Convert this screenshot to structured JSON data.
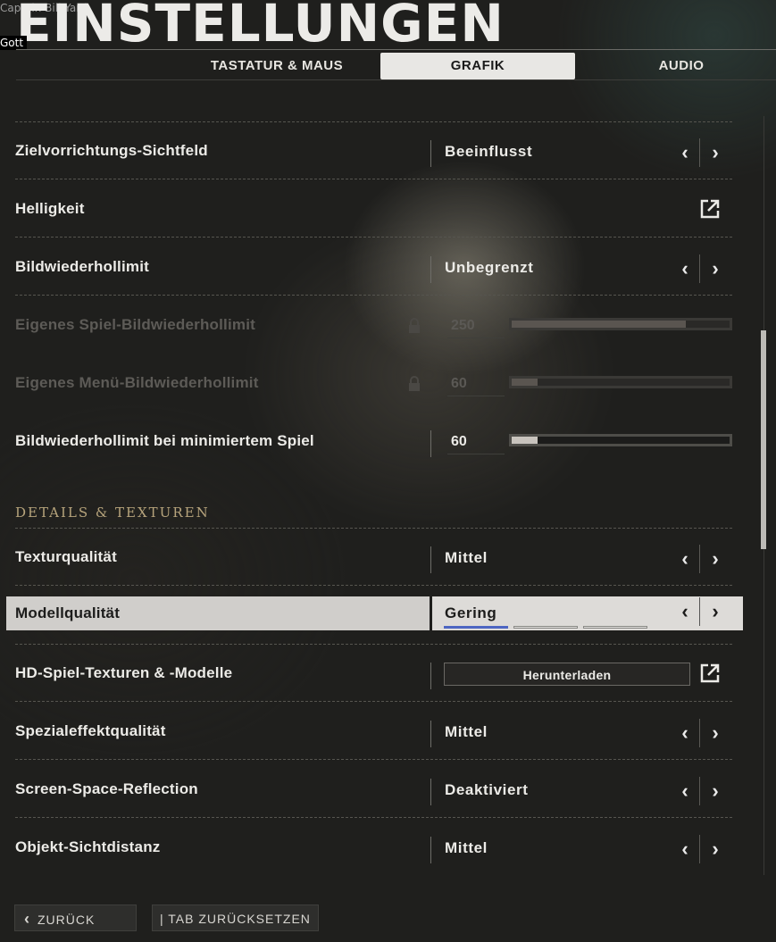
{
  "window_overlay": {
    "title": "Captain Bill Yard",
    "tag": "Gott"
  },
  "header": {
    "title": "EINSTELLUNGEN"
  },
  "tabs": [
    {
      "label": "TASTATUR & MAUS",
      "active": false
    },
    {
      "label": "GRAFIK",
      "active": true
    },
    {
      "label": "AUDIO",
      "active": false
    }
  ],
  "rows": {
    "aim_fov": {
      "label": "Zielvorrichtungs-Sichtfeld",
      "value": "Beeinflusst"
    },
    "brightness": {
      "label": "Helligkeit"
    },
    "framerate_limit": {
      "label": "Bildwiederhollimit",
      "value": "Unbegrenzt"
    },
    "custom_game_limit": {
      "label": "Eigenes Spiel-Bildwiederhollimit",
      "value": "250",
      "level": 0.8,
      "disabled": true
    },
    "custom_menu_limit": {
      "label": "Eigenes Menü-Bildwiederhollimit",
      "value": "60",
      "level": 0.12,
      "disabled": true
    },
    "minimized_limit": {
      "label": "Bildwiederhollimit bei minimiertem Spiel",
      "value": "60",
      "level": 0.12
    }
  },
  "section": {
    "title": "DETAILS & TEXTUREN"
  },
  "detail_rows": {
    "texture_quality": {
      "label": "Texturqualität",
      "value": "Mittel"
    },
    "model_quality": {
      "label": "Modellqualität",
      "value": "Gering",
      "segments_on": 1,
      "segments_total": 3
    },
    "hd_textures": {
      "label": "HD-Spiel-Texturen & -Modelle",
      "button": "Herunterladen"
    },
    "special_effects": {
      "label": "Spezialeffektqualität",
      "value": "Mittel"
    },
    "ssr": {
      "label": "Screen-Space-Reflection",
      "value": "Deaktiviert"
    },
    "object_distance": {
      "label": "Objekt-Sichtdistanz",
      "value": "Mittel"
    }
  },
  "footer": {
    "back": "ZURÜCK",
    "reset": "| TAB ZURÜCKSETZEN"
  },
  "colors": {
    "accent_blue": "#4d66c2",
    "section_gold": "#b7a47c",
    "highlight": "#dddbd8"
  },
  "icons": {
    "prev": "chevron-left-icon",
    "next": "chevron-right-icon",
    "external": "external-link-icon",
    "lock": "lock-icon"
  }
}
